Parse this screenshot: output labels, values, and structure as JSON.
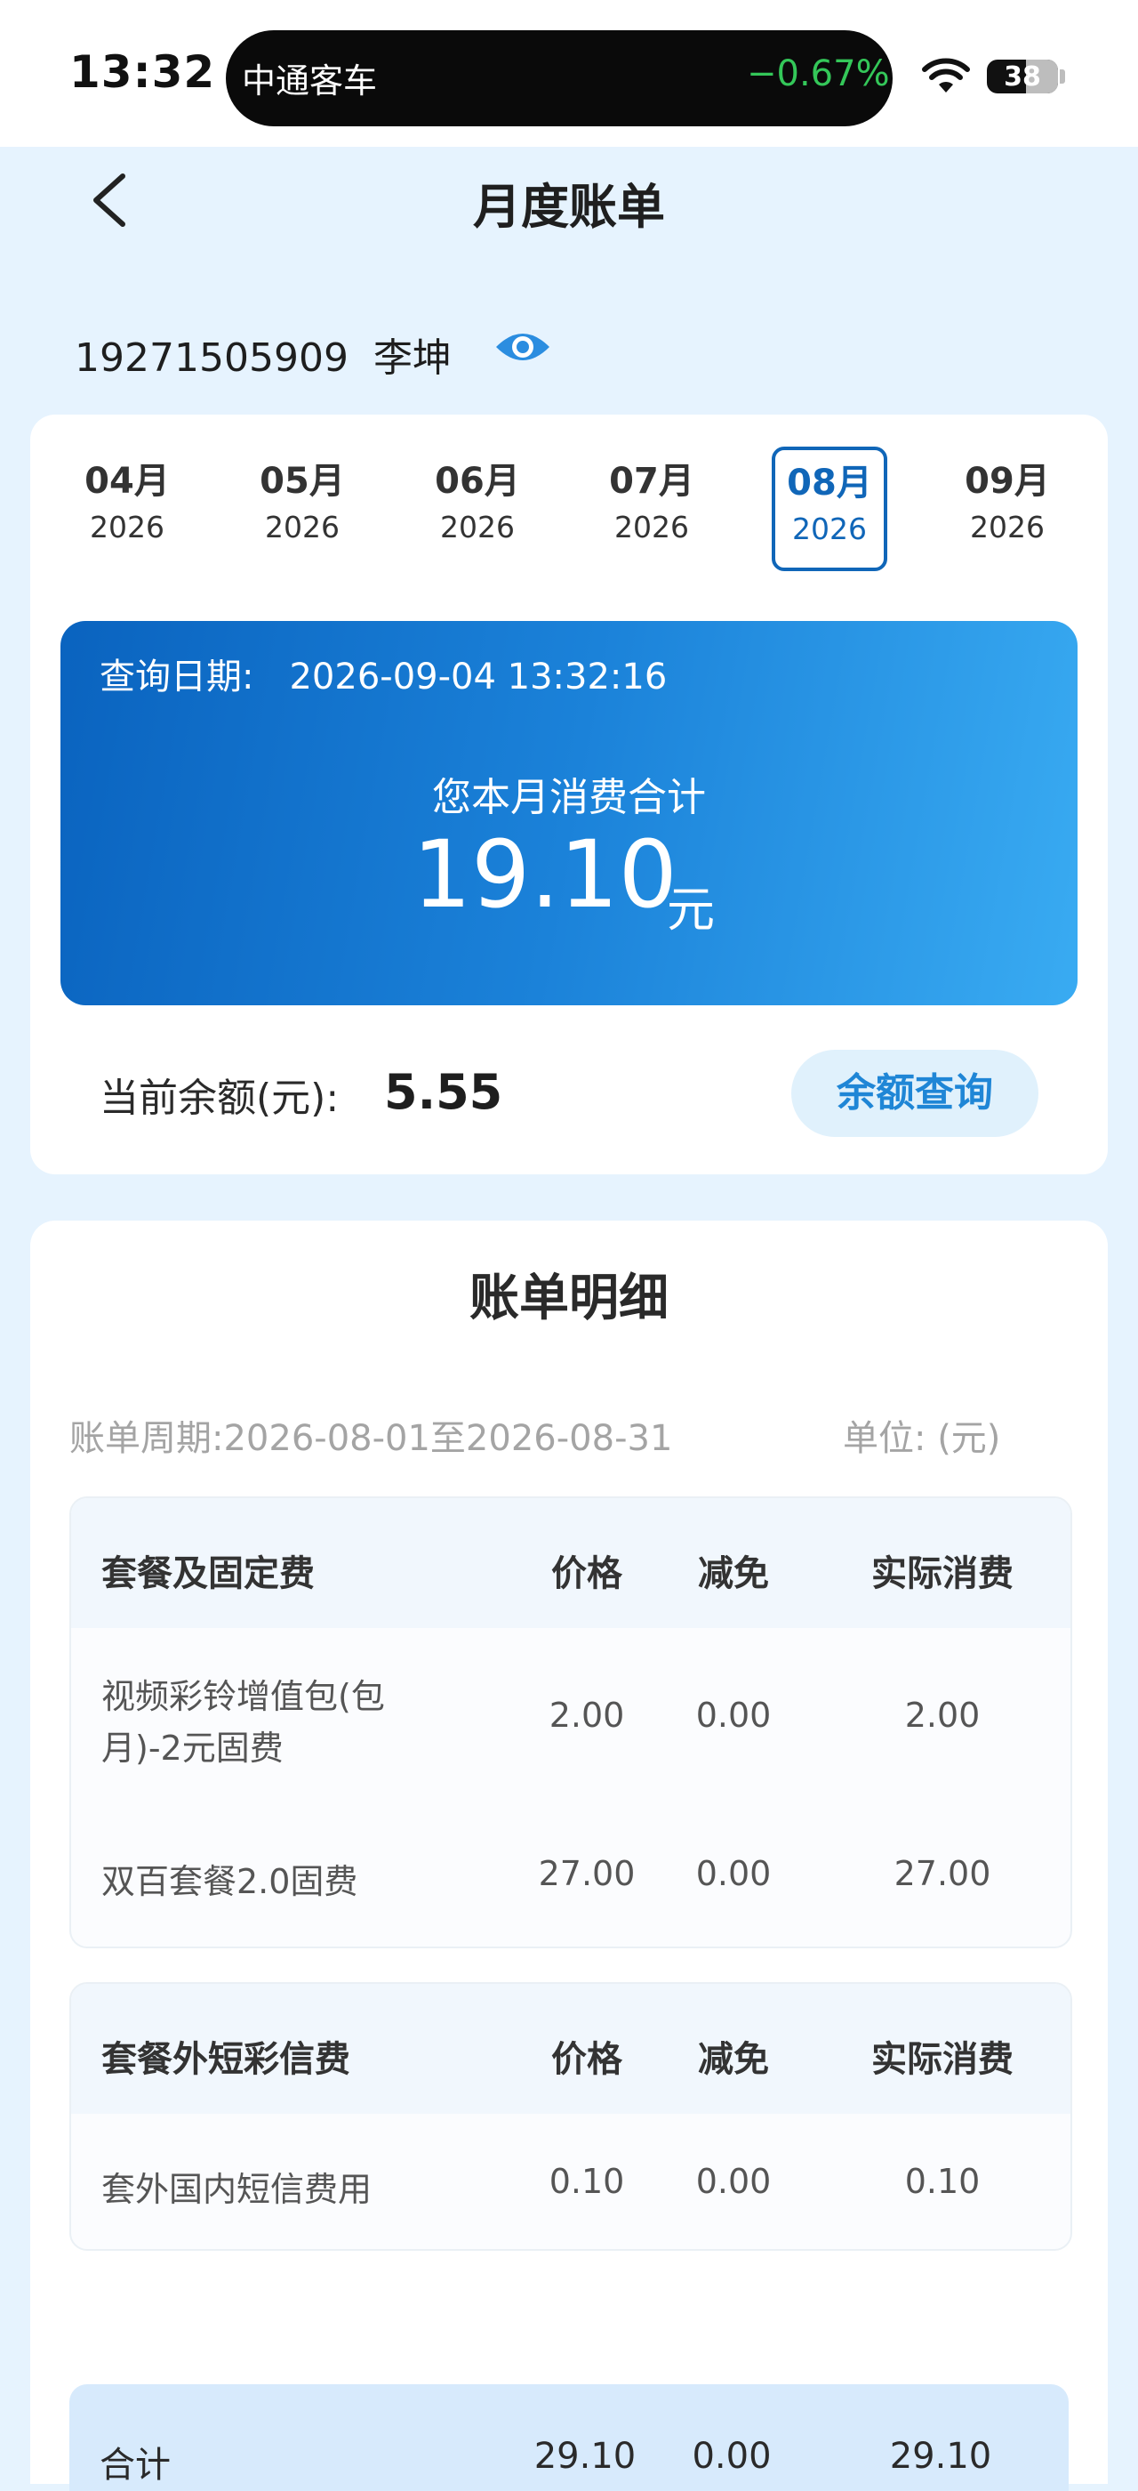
{
  "status_bar": {
    "time": "13:32",
    "island_app": "中通客车",
    "island_change": "−0.67%",
    "battery": "38"
  },
  "nav": {
    "title": "月度账单"
  },
  "user": {
    "phone": "19271505909",
    "name": "李坤"
  },
  "months": [
    {
      "month": "04月",
      "year": "2026"
    },
    {
      "month": "05月",
      "year": "2026"
    },
    {
      "month": "06月",
      "year": "2026"
    },
    {
      "month": "07月",
      "year": "2026"
    },
    {
      "month": "08月",
      "year": "2026"
    },
    {
      "month": "09月",
      "year": "2026"
    }
  ],
  "selected_month_index": 4,
  "summary": {
    "query_label": "查询日期:",
    "query_date": "2026-09-04 13:32:16",
    "spend_label": "您本月消费合计",
    "spend_value": "19.10",
    "spend_unit": "元",
    "balance_label": "当前余额(元):",
    "balance_value": "5.55",
    "balance_button": "余额查询"
  },
  "detail": {
    "title": "账单明细",
    "period": "账单周期:2026-08-01至2026-08-31",
    "unit": "单位: (元)",
    "sections": [
      {
        "header": [
          "套餐及固定费",
          "价格",
          "减免",
          "实际消费"
        ],
        "rows": [
          [
            "视频彩铃增值包(包月)-2元固费",
            "2.00",
            "0.00",
            "2.00"
          ],
          [
            "双百套餐2.0固费",
            "27.00",
            "0.00",
            "27.00"
          ]
        ]
      },
      {
        "header": [
          "套餐外短彩信费",
          "价格",
          "减免",
          "实际消费"
        ],
        "rows": [
          [
            "套外国内短信费用",
            "0.10",
            "0.00",
            "0.10"
          ]
        ]
      }
    ],
    "total": [
      "合计",
      "29.10",
      "0.00",
      "29.10"
    ]
  },
  "colors": {
    "accent": "#1066b8",
    "gradient_start": "#0a63bf",
    "gradient_end": "#39abf2",
    "page_bg": "#e6f3fe",
    "stock_green": "#34c759"
  }
}
